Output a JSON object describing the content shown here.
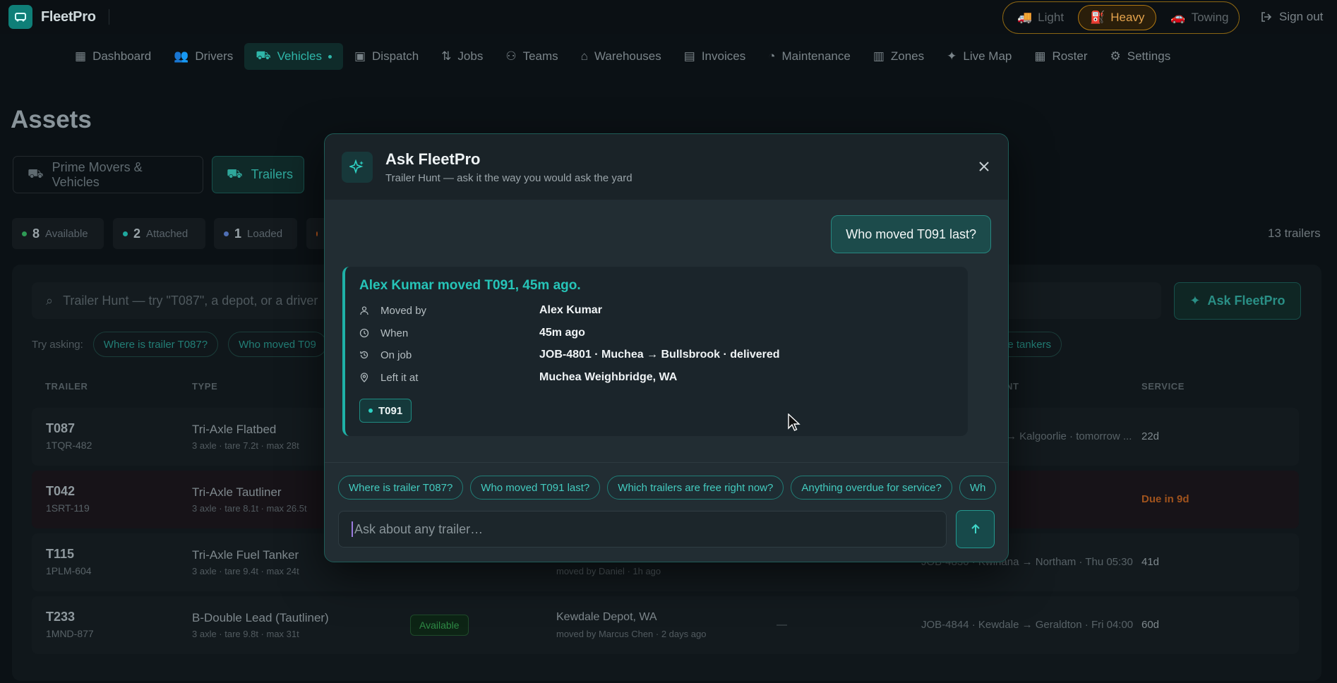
{
  "app": {
    "name": "FleetPro"
  },
  "modes": [
    {
      "label": "Light",
      "icon": "truck-icon"
    },
    {
      "label": "Heavy",
      "icon": "fuel-pump-icon",
      "active": true
    },
    {
      "label": "Towing",
      "icon": "car-icon"
    }
  ],
  "signout_label": "Sign out",
  "nav": [
    {
      "label": "Dashboard",
      "icon": "grid-icon"
    },
    {
      "label": "Drivers",
      "icon": "users-icon"
    },
    {
      "label": "Vehicles",
      "icon": "vehicle-icon",
      "active": true
    },
    {
      "label": "Dispatch",
      "icon": "package-icon"
    },
    {
      "label": "Jobs",
      "icon": "route-icon"
    },
    {
      "label": "Teams",
      "icon": "team-icon"
    },
    {
      "label": "Warehouses",
      "icon": "warehouse-icon"
    },
    {
      "label": "Invoices",
      "icon": "invoice-icon"
    },
    {
      "label": "Maintenance",
      "icon": "gauge-icon"
    },
    {
      "label": "Zones",
      "icon": "map-icon"
    },
    {
      "label": "Live Map",
      "icon": "satellite-icon"
    },
    {
      "label": "Roster",
      "icon": "calendar-icon"
    },
    {
      "label": "Settings",
      "icon": "gear-icon"
    }
  ],
  "page": {
    "title": "Assets"
  },
  "tabs": [
    {
      "label": "Prime Movers & Vehicles"
    },
    {
      "label": "Trailers",
      "active": true
    }
  ],
  "status_chips": [
    {
      "count": "8",
      "label": "Available",
      "color": "#2e9a55"
    },
    {
      "count": "2",
      "label": "Attached",
      "color": "#1fa89e"
    },
    {
      "count": "1",
      "label": "Loaded",
      "color": "#4f6fb5"
    }
  ],
  "trailer_count": "13 trailers",
  "search": {
    "placeholder": "Trailer Hunt — try \"T087\", a depot, or a driver"
  },
  "ask_button": "Ask FleetPro",
  "try_label": "Try asking:",
  "try_chips": [
    "Where is trailer T087?",
    "Who moved T09"
  ],
  "try_chip_tail": "he tankers",
  "columns": {
    "trailer": "TRAILER",
    "type": "TYPE",
    "next": "NT",
    "service": "SERVICE"
  },
  "rows": [
    {
      "id": "T087",
      "plate": "1TQR-482",
      "type": "Tri-Axle Flatbed",
      "spec": "3 axle · tare 7.2t · max 28t",
      "status": "",
      "location": "",
      "location_sub": "",
      "attached": "",
      "next": "→ Kalgoorlie · tomorrow ...",
      "service": "22d",
      "service_warn": false
    },
    {
      "id": "T042",
      "plate": "1SRT-119",
      "type": "Tri-Axle Tautliner",
      "spec": "3 axle · tare 8.1t · max 26.5t",
      "status": "",
      "location": "",
      "location_sub": "",
      "attached": "",
      "next": "",
      "service": "Due in 9d",
      "service_warn": true
    },
    {
      "id": "T115",
      "plate": "1PLM-604",
      "type": "Tri-Axle Fuel Tanker",
      "spec": "3 axle · tare 9.4t · max 24t",
      "status": "",
      "location": "",
      "location_sub": "moved by Daniel · 1h ago",
      "attached": "",
      "next": "JOB-4830 · Kwinana → Northam · Thu 05:30",
      "service": "41d",
      "service_warn": false
    },
    {
      "id": "T233",
      "plate": "1MND-877",
      "type": "B-Double Lead (Tautliner)",
      "spec": "3 axle · tare 9.8t · max 31t",
      "status": "Available",
      "location": "Kewdale Depot, WA",
      "location_sub": "moved by Marcus Chen · 2 days ago",
      "attached": "—",
      "next": "JOB-4844 · Kewdale → Geraldton · Fri 04:00",
      "service": "60d",
      "service_warn": false
    }
  ],
  "modal": {
    "title": "Ask FleetPro",
    "subtitle": "Trailer Hunt — ask it the way you would ask the yard",
    "question": "Who moved T091 last?",
    "answer": {
      "headline": "Alex Kumar moved T091, 45m ago.",
      "facts": [
        {
          "icon": "person-icon",
          "key": "Moved by",
          "value": "Alex Kumar"
        },
        {
          "icon": "clock-icon",
          "key": "When",
          "value": "45m ago"
        },
        {
          "icon": "history-icon",
          "key": "On job",
          "value": "JOB-4801 · Muchea → Bullsbrook · delivered"
        },
        {
          "icon": "pin-icon",
          "key": "Left it at",
          "value": "Muchea Weighbridge, WA"
        }
      ],
      "tag": "T091"
    },
    "suggestions": [
      "Where is trailer T087?",
      "Who moved T091 last?",
      "Which trailers are free right now?",
      "Anything overdue for service?",
      "Wh"
    ],
    "input_placeholder": "Ask about any trailer…"
  }
}
